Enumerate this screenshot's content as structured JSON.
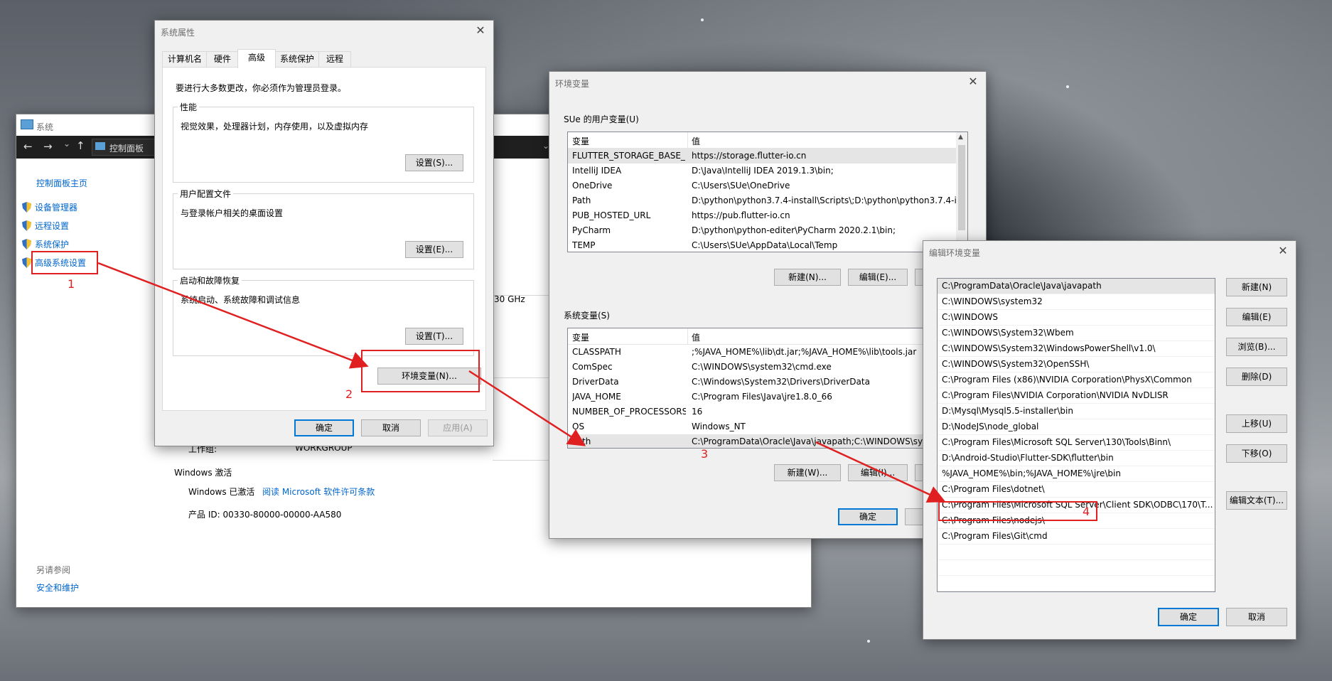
{
  "system_window": {
    "title": "系统",
    "address": "控制面板",
    "sidebar_home": "控制面板主页",
    "sidebar_items": [
      "设备管理器",
      "远程设置",
      "系统保护",
      "高级系统设置"
    ],
    "see_also_title": "另请参阅",
    "see_also_items": [
      "安全和维护"
    ],
    "cpu_fragment": "30 GHz",
    "workgroup_label": "工作组:",
    "workgroup_value": "WORKGROUP",
    "activation_section": "Windows 激活",
    "activation_status": "Windows 已激活",
    "activation_link": "阅读 Microsoft 软件许可条款",
    "product_id": "产品 ID: 00330-80000-00000-AA580"
  },
  "sysprops": {
    "title": "系统属性",
    "tabs": [
      "计算机名",
      "硬件",
      "高级",
      "系统保护",
      "远程"
    ],
    "active_tab": "高级",
    "notice": "要进行大多数更改，你必须作为管理员登录。",
    "performance": {
      "title": "性能",
      "desc": "视觉效果，处理器计划，内存使用，以及虚拟内存",
      "button": "设置(S)..."
    },
    "profile": {
      "title": "用户配置文件",
      "desc": "与登录帐户相关的桌面设置",
      "button": "设置(E)..."
    },
    "startup": {
      "title": "启动和故障恢复",
      "desc": "系统启动、系统故障和调试信息",
      "button": "设置(T)..."
    },
    "env_button": "环境变量(N)...",
    "ok": "确定",
    "cancel": "取消",
    "apply": "应用(A)"
  },
  "envvars": {
    "title": "环境变量",
    "user_group": "SUe 的用户变量(U)",
    "col_var": "变量",
    "col_val": "值",
    "user_rows": [
      {
        "name": "FLUTTER_STORAGE_BASE_...",
        "value": "https://storage.flutter-io.cn"
      },
      {
        "name": "IntelliJ IDEA",
        "value": "D:\\Java\\IntelliJ IDEA 2019.1.3\\bin;"
      },
      {
        "name": "OneDrive",
        "value": "C:\\Users\\SUe\\OneDrive"
      },
      {
        "name": "Path",
        "value": "D:\\python\\python3.7.4-install\\Scripts\\;D:\\python\\python3.7.4-i..."
      },
      {
        "name": "PUB_HOSTED_URL",
        "value": "https://pub.flutter-io.cn"
      },
      {
        "name": "PyCharm",
        "value": "D:\\python\\python-editer\\PyCharm 2020.2.1\\bin;"
      },
      {
        "name": "TEMP",
        "value": "C:\\Users\\SUe\\AppData\\Local\\Temp"
      }
    ],
    "user_new": "新建(N)...",
    "user_edit": "编辑(E)...",
    "sys_group": "系统变量(S)",
    "sys_rows": [
      {
        "name": "CLASSPATH",
        "value": ";%JAVA_HOME%\\lib\\dt.jar;%JAVA_HOME%\\lib\\tools.jar"
      },
      {
        "name": "ComSpec",
        "value": "C:\\WINDOWS\\system32\\cmd.exe"
      },
      {
        "name": "DriverData",
        "value": "C:\\Windows\\System32\\Drivers\\DriverData"
      },
      {
        "name": "JAVA_HOME",
        "value": "C:\\Program Files\\Java\\jre1.8.0_66"
      },
      {
        "name": "NUMBER_OF_PROCESSORS",
        "value": "16"
      },
      {
        "name": "OS",
        "value": "Windows_NT"
      },
      {
        "name": "Path",
        "value": "C:\\ProgramData\\Oracle\\Java\\javapath;C:\\WINDOWS\\sys"
      }
    ],
    "sys_new": "新建(W)...",
    "sys_edit": "编辑(I)...",
    "ok": "确定"
  },
  "editenv": {
    "title": "编辑环境变量",
    "paths": [
      "C:\\ProgramData\\Oracle\\Java\\javapath",
      "C:\\WINDOWS\\system32",
      "C:\\WINDOWS",
      "C:\\WINDOWS\\System32\\Wbem",
      "C:\\WINDOWS\\System32\\WindowsPowerShell\\v1.0\\",
      "C:\\WINDOWS\\System32\\OpenSSH\\",
      "C:\\Program Files (x86)\\NVIDIA Corporation\\PhysX\\Common",
      "C:\\Program Files\\NVIDIA Corporation\\NVIDIA NvDLISR",
      "D:\\Mysql\\Mysql5.5-installer\\bin",
      "D:\\NodeJS\\node_global",
      "C:\\Program Files\\Microsoft SQL Server\\130\\Tools\\Binn\\",
      "D:\\Android-Studio\\Flutter-SDK\\flutter\\bin",
      "%JAVA_HOME%\\bin;%JAVA_HOME%\\jre\\bin",
      "C:\\Program Files\\dotnet\\",
      "C:\\Program Files\\Microsoft SQL Server\\Client SDK\\ODBC\\170\\T...",
      "C:\\Program Files\\nodejs\\",
      "C:\\Program Files\\Git\\cmd"
    ],
    "buttons": [
      "新建(N)",
      "编辑(E)",
      "浏览(B)...",
      "删除(D)",
      "上移(U)",
      "下移(O)",
      "编辑文本(T)..."
    ],
    "ok": "确定",
    "cancel": "取消"
  },
  "annotations": {
    "n1": "1",
    "n2": "2",
    "n3": "3",
    "n4": "4",
    "color": "#e02020"
  }
}
